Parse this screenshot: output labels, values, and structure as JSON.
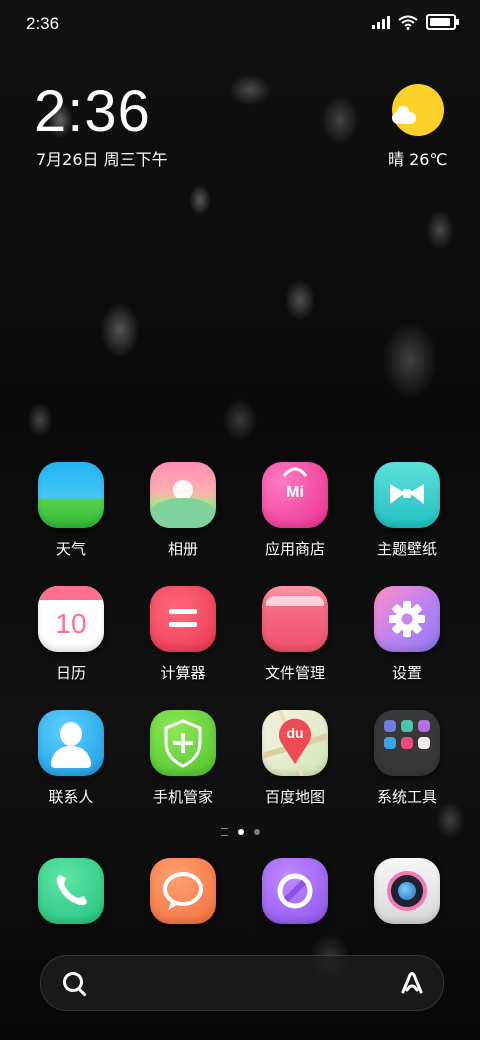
{
  "status_bar": {
    "time": "2:36",
    "battery_percent": 90
  },
  "widget": {
    "clock": "2:36",
    "date": "7月26日 周三下午",
    "weather": "晴 26℃"
  },
  "apps": [
    {
      "label": "天气",
      "icon": "weather-icon"
    },
    {
      "label": "相册",
      "icon": "gallery-icon"
    },
    {
      "label": "应用商店",
      "icon": "app-store-icon",
      "mark": "Mi"
    },
    {
      "label": "主题壁纸",
      "icon": "themes-icon"
    },
    {
      "label": "日历",
      "icon": "calendar-icon",
      "day": "10"
    },
    {
      "label": "计算器",
      "icon": "calculator-icon"
    },
    {
      "label": "文件管理",
      "icon": "file-manager-icon"
    },
    {
      "label": "设置",
      "icon": "settings-icon"
    },
    {
      "label": "联系人",
      "icon": "contacts-icon"
    },
    {
      "label": "手机管家",
      "icon": "security-icon"
    },
    {
      "label": "百度地图",
      "icon": "baidu-map-icon",
      "mark": "du"
    },
    {
      "label": "系统工具",
      "icon": "folder-icon"
    }
  ],
  "dock": [
    {
      "icon": "phone-icon"
    },
    {
      "icon": "messages-icon"
    },
    {
      "icon": "browser-icon"
    },
    {
      "icon": "camera-icon"
    }
  ],
  "page_indicator": {
    "pages": 2,
    "active": 1
  }
}
